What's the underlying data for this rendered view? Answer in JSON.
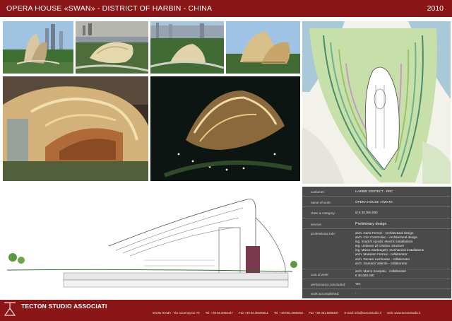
{
  "header": {
    "title": "OPERA HOUSE «SWAN» - DISTRICT OF HARBIN - CHINA",
    "year": "2010"
  },
  "info": {
    "customer_label": "customer:",
    "customer": "HARBIN DISTRICT - PRC",
    "work_label": "name of work:",
    "work": "OPERA HOUSE «SWAN»",
    "class_label": "class & category:",
    "class": "id € 30.000.000",
    "service_label": "service:",
    "service": "Preliminary design",
    "role_label": "professional role:",
    "roles": [
      "arch. Carlo Ferroni - Architectural design",
      "arch. Ciro Cuozzolino - Architectural design",
      "ing. Imad Al Ayoubi: electric installations",
      "ing. Umberto Di Cristina: structure",
      "ing. Marco Santangelo: mechanical installations",
      "arch. Massimo Ferroni - collaborator",
      "arch. Renato Lamboese - collaborator",
      "arch. Gaetano Valente - collaborator",
      "arch. Marco Scarpato - collaborator"
    ],
    "cost_label": "cost of work:",
    "cost": "€ 30.000.000",
    "performance_label": "performance concluded:",
    "performance": "Yes",
    "accomplished_label": "work accomplished:",
    "accomplished": "-"
  },
  "footer": {
    "studio": "TECTON STUDIO ASSOCIATI",
    "address": "00135 ROMA - Via Courmayeur 79",
    "tel1": "Tel. +39 06.3058447",
    "fax1": "Fax +39 06.35506611",
    "tel2": "Tel. +39 081.5086262",
    "fax2": "Fax +39 081.5086487",
    "email": "E-mail: info@tectonstudio.it",
    "web": "web: www.tectonstudio.it"
  },
  "colors": {
    "brand": "#8a1618",
    "panel": "#4a4a4a"
  }
}
